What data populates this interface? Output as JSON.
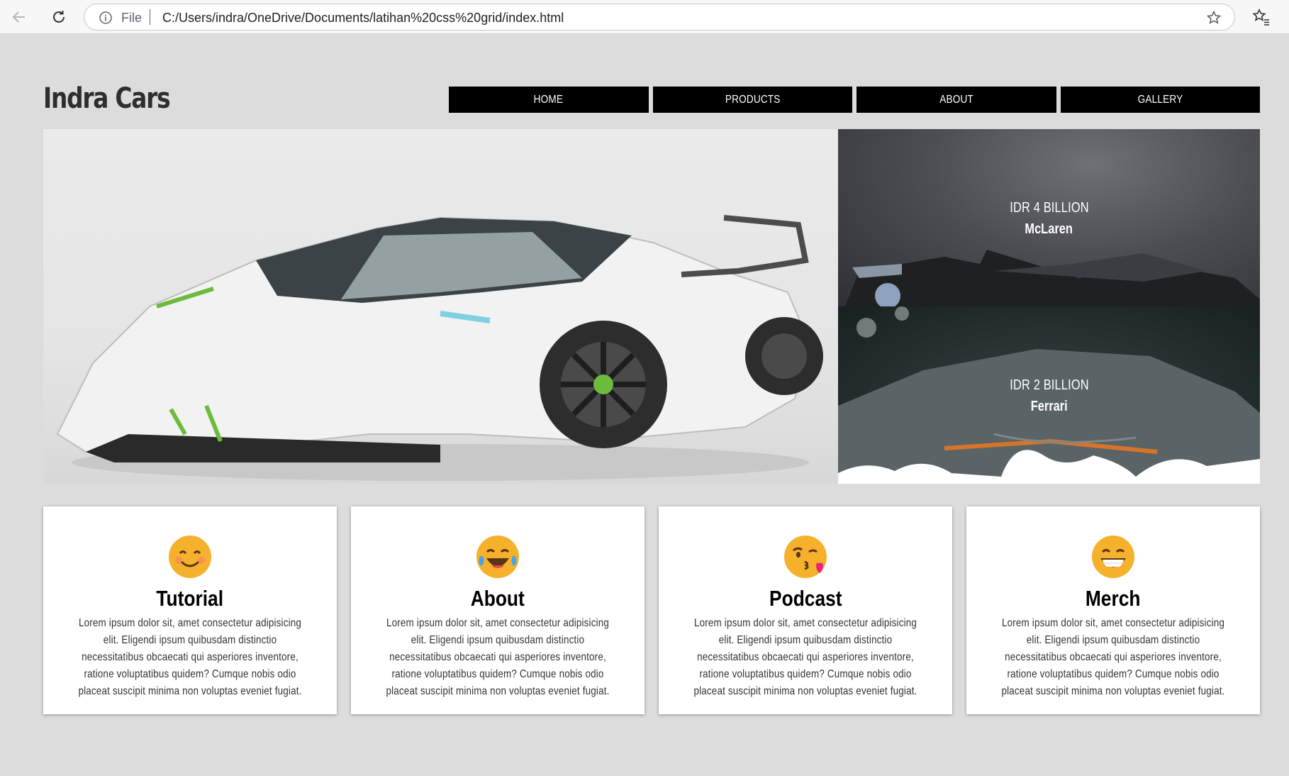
{
  "browser": {
    "scheme": "File",
    "url": "C:/Users/indra/OneDrive/Documents/latihan%20css%20grid/index.html"
  },
  "site": {
    "brand": "Indra Cars",
    "menu": [
      "HOME",
      "PRODUCTS",
      "ABOUT",
      "GALLERY"
    ]
  },
  "featured": [
    {
      "price": "IDR 4 BILLION",
      "name": "McLaren"
    },
    {
      "price": "IDR 2 BILLION",
      "name": "Ferrari"
    }
  ],
  "cards": [
    {
      "title": "Tutorial",
      "emoji": "smiling-face-icon",
      "text": "Lorem ipsum dolor sit, amet consectetur adipisicing elit. Eligendi ipsum quibusdam distinctio necessitatibus obcaecati qui asperiores inventore, ratione voluptatibus quidem? Cumque nobis odio placeat suscipit minima non voluptas eveniet fugiat."
    },
    {
      "title": "About",
      "emoji": "tears-of-joy-icon",
      "text": "Lorem ipsum dolor sit, amet consectetur adipisicing elit. Eligendi ipsum quibusdam distinctio necessitatibus obcaecati qui asperiores inventore, ratione voluptatibus quidem? Cumque nobis odio placeat suscipit minima non voluptas eveniet fugiat."
    },
    {
      "title": "Podcast",
      "emoji": "blowing-kiss-icon",
      "text": "Lorem ipsum dolor sit, amet consectetur adipisicing elit. Eligendi ipsum quibusdam distinctio necessitatibus obcaecati qui asperiores inventore, ratione voluptatibus quidem? Cumque nobis odio placeat suscipit minima non voluptas eveniet fugiat."
    },
    {
      "title": "Merch",
      "emoji": "grinning-face-icon",
      "text": "Lorem ipsum dolor sit, amet consectetur adipisicing elit. Eligendi ipsum quibusdam distinctio necessitatibus obcaecati qui asperiores inventore, ratione voluptatibus quidem? Cumque nobis odio placeat suscipit minima non voluptas eveniet fugiat."
    }
  ],
  "colors": {
    "page_bg": "#dcdcdc",
    "menu_bg": "#000000",
    "emoji_yellow": "#f6b12c"
  }
}
